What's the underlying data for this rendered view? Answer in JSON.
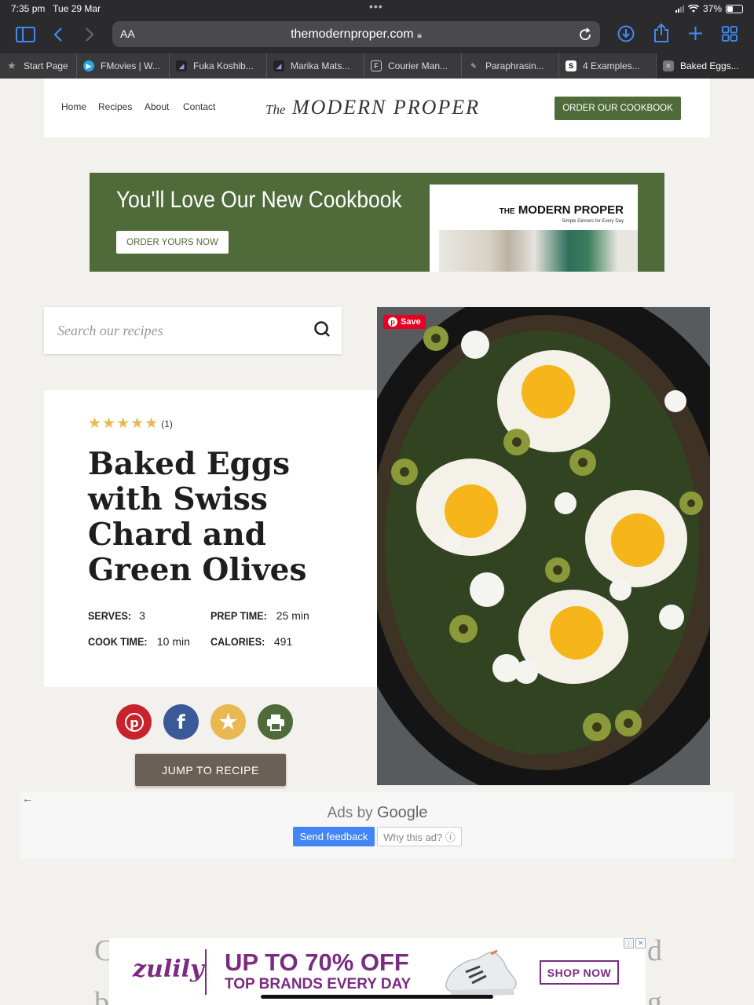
{
  "statusbar": {
    "time": "7:35 pm",
    "date": "Tue 29 Mar",
    "battery": "37%"
  },
  "browser": {
    "aa_label": "AA",
    "url": "themodernproper.com",
    "tabs": [
      {
        "label": "Start Page",
        "icon": "star-icon"
      },
      {
        "label": "FMovies | W...",
        "icon": "play-icon"
      },
      {
        "label": "Fuka Koshib...",
        "icon": "site-icon"
      },
      {
        "label": "Marika Mats...",
        "icon": "site-icon"
      },
      {
        "label": "Courier Man...",
        "icon": "f-icon"
      },
      {
        "label": "Paraphrasin...",
        "icon": "quill-icon"
      },
      {
        "label": "4 Examples...",
        "icon": "s-icon"
      },
      {
        "label": "Baked Eggs...",
        "icon": "close-icon"
      }
    ]
  },
  "header": {
    "nav": [
      "Home",
      "Recipes",
      "About",
      "Contact"
    ],
    "logo_the": "The",
    "logo_main": "MODERN PROPER",
    "cookbook_button": "ORDER OUR COOKBOOK"
  },
  "banner": {
    "headline": "You'll Love Our New Cookbook",
    "button": "ORDER YOURS NOW",
    "book_the": "THE",
    "book_title": "MODERN PROPER",
    "book_subtitle": "Simple Dinners for Every Day"
  },
  "search": {
    "placeholder": "Search our recipes"
  },
  "recipe": {
    "rating_stars": 5,
    "rating_count": "(1)",
    "title": "Baked Eggs with Swiss Chard and Green Olives",
    "serves_label": "SERVES:",
    "serves": "3",
    "prep_label": "PREP TIME:",
    "prep": "25 min",
    "cook_label": "COOK TIME:",
    "cook": "10 min",
    "calories_label": "CALORIES:",
    "calories": "491",
    "jump_button": "JUMP TO RECIPE",
    "pin_save": "Save"
  },
  "share_colors": {
    "pinterest": "#c8232c",
    "facebook": "#3b5998",
    "favorite": "#e9b851",
    "print": "#4f6b3a"
  },
  "ads": {
    "ads_by": "Ads by",
    "google": "Google",
    "send_feedback": "Send feedback",
    "why_ad": "Why this ad? ⓘ"
  },
  "body_text": {
    "line1_start": "C",
    "line1_end": "d",
    "line2_start": "b",
    "line2_end": "g"
  },
  "bottom_ad": {
    "brand": "zulily",
    "headline": "UP TO 70% OFF",
    "subline": "TOP BRANDS EVERY DAY",
    "cta": "SHOP NOW"
  },
  "colors": {
    "brand_green": "#4f6b3a",
    "zulily_purple": "#7a2b82",
    "star_gold": "#e9b851"
  }
}
